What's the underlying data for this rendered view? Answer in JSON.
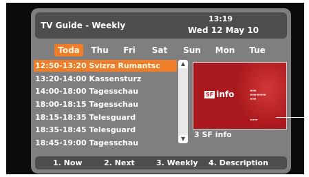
{
  "header": {
    "title": "TV Guide - Weekly",
    "time": "13:19",
    "date": "Wed 12 May 10"
  },
  "days": [
    "Toda",
    "Thu",
    "Fri",
    "Sat",
    "Sun",
    "Mon",
    "Tue"
  ],
  "selected_day": "Toda",
  "programs": [
    "12:50-13:20 Svizra Rumantsc",
    "13:20-14:00 Kassensturz",
    "14:00-18:00 Tagesschau",
    "18:00-18:15 Tagesschau",
    "18:15-18:35 Telesguard",
    "18:35-18:45 Telesguard",
    "18:45-19:00 Tagesschau"
  ],
  "preview": {
    "logo_badge": "SF",
    "logo_text": "info",
    "channel_label": "3 SF info"
  },
  "footer": {
    "now": "1. Now",
    "next": "2. Next",
    "weekly": "3. Weekly",
    "description": "4. Description"
  },
  "colors": {
    "accent": "#f07d2a",
    "panel": "#7f7f7f",
    "bar": "#4d4d4d"
  }
}
